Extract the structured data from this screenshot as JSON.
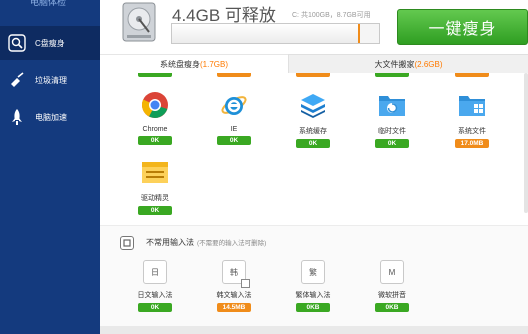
{
  "sidebar": {
    "top_label": "电脑体检",
    "items": [
      {
        "label": "C盘瘦身",
        "icon": "disk-slim-icon",
        "active": true
      },
      {
        "label": "垃圾清理",
        "icon": "broom-icon",
        "active": false
      },
      {
        "label": "电脑加速",
        "icon": "rocket-icon",
        "active": false
      }
    ]
  },
  "header": {
    "free_space": "4.4GB 可释放",
    "capacity": "C: 共100GB，8.7GB可用",
    "used_fraction": 0.91,
    "action_button": "一键瘦身"
  },
  "tabs": [
    {
      "label": "系统盘瘦身",
      "size": "(1.7GB)",
      "active": true
    },
    {
      "label": "大文件搬家",
      "size": "(2.6GB)",
      "active": false
    }
  ],
  "apps": [
    {
      "name": "Chrome",
      "badge": "0K",
      "icon": "chrome-icon",
      "badge_color": "#3aa822"
    },
    {
      "name": "IE",
      "badge": "0K",
      "icon": "ie-icon",
      "badge_color": "#3aa822"
    },
    {
      "name": "系统缓存",
      "badge": "0K",
      "icon": "layers-icon",
      "badge_color": "#3aa822"
    },
    {
      "name": "临时文件",
      "badge": "0K",
      "icon": "temp-folder-icon",
      "badge_color": "#3aa822"
    },
    {
      "name": "系统文件",
      "badge": "17.0MB",
      "icon": "system-folder-icon",
      "badge_color": "#f08c1a"
    },
    {
      "name": "驱动精灵",
      "badge": "0K",
      "icon": "driver-folder-icon",
      "badge_color": "#3aa822"
    }
  ],
  "ime_section": {
    "title": "不常用输入法",
    "subtitle": "(不需要的输入法可删除)",
    "items": [
      {
        "name": "日文输入法",
        "key": "日",
        "badge": "0K",
        "badge_color": "#3aa822"
      },
      {
        "name": "韩文输入法",
        "key": "韩",
        "badge": "14.5MB",
        "badge_color": "#f08c1a"
      },
      {
        "name": "繁体输入法",
        "key": "繁",
        "badge": "0KB",
        "badge_color": "#3aa822"
      },
      {
        "name": "微软拼音",
        "key": "M",
        "badge": "0KB",
        "badge_color": "#3aa822"
      }
    ]
  }
}
